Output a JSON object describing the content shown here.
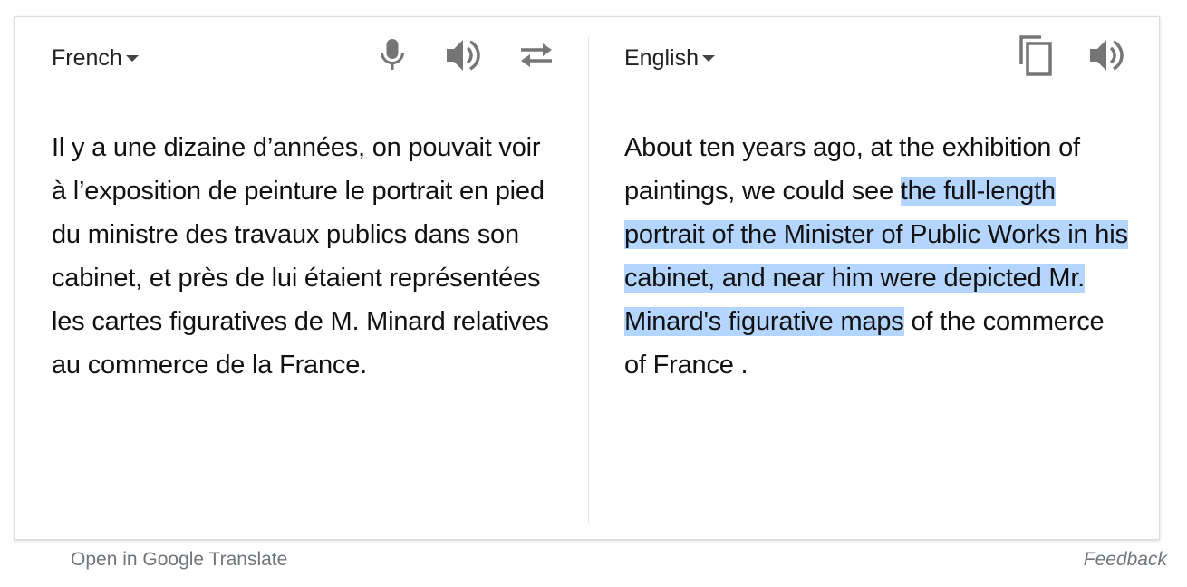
{
  "source": {
    "language": "French",
    "text": "Il y a une dizaine d’années, on pouvait voir à l’exposition de peinture le portrait en pied du ministre des travaux publics dans son cabinet, et près de lui étaient représentées les cartes figuratives de M. Minard relatives au commerce de la France."
  },
  "target": {
    "language": "English",
    "text_before": "About ten years ago, at the exhibition of paintings, we could see ",
    "text_highlighted": "the full-length portrait of the Minister of Public Works in his cabinet, and near him were depicted Mr. Minard's figurative maps",
    "text_after": " of the commerce of France ."
  },
  "icons": {
    "microphone": "mic-icon",
    "source_speaker": "speaker-icon",
    "swap": "swap-arrows-icon",
    "copy": "copy-icon",
    "target_speaker": "speaker-icon"
  },
  "colors": {
    "highlight": "#b4d5fe",
    "icon": "#757575",
    "text": "#111111",
    "footer_text": "#70757a"
  },
  "footer": {
    "open_link": "Open in Google Translate",
    "feedback": "Feedback"
  }
}
